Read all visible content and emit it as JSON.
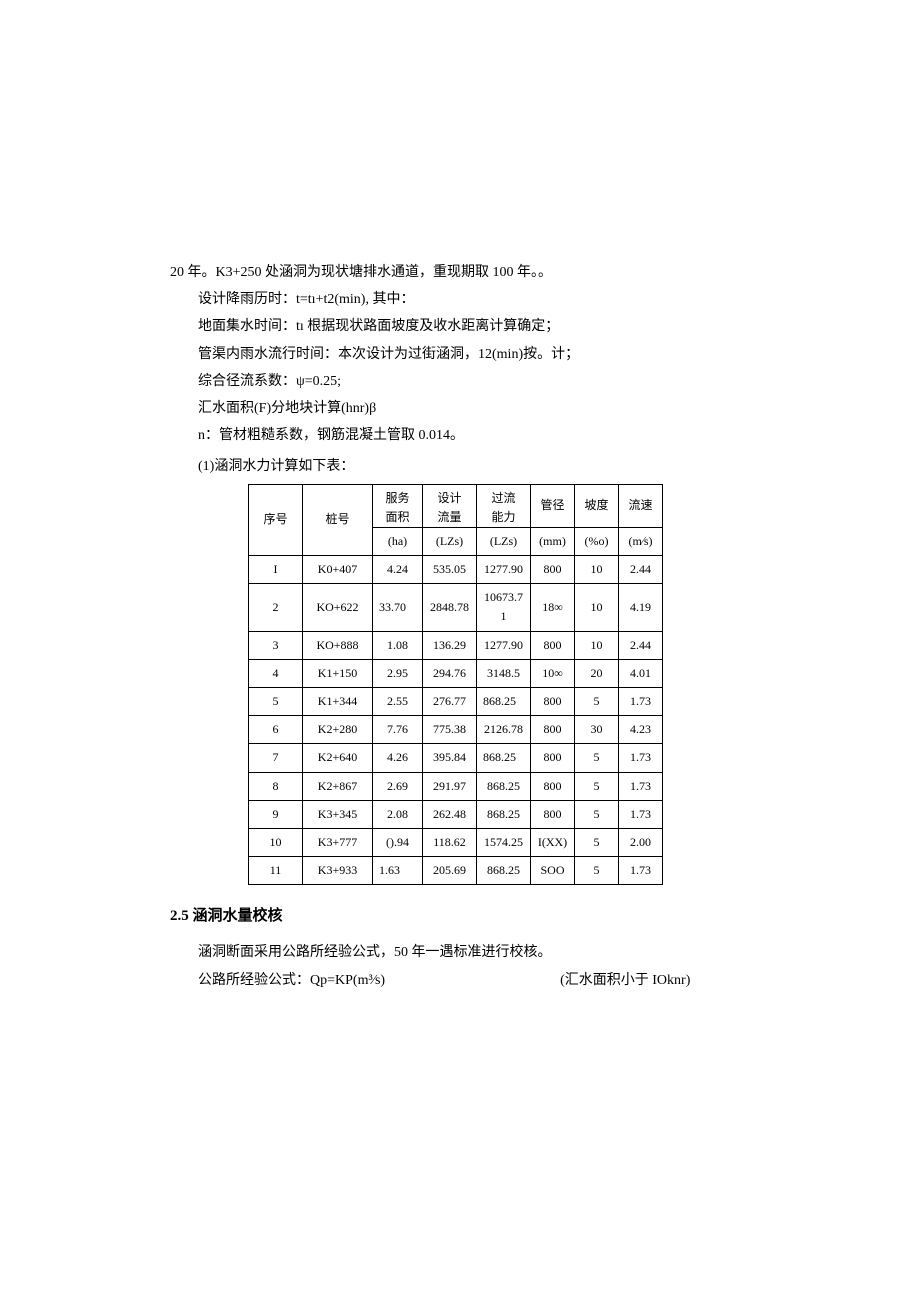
{
  "intro": {
    "line1": "20 年。K3+250 处涵洞为现状塘排水通道，重现期取 100 年。。",
    "line2": "设计降雨历时：t=tı+t2(min), 其中：",
    "line3": "地面集水时间：tı 根据现状路面坡度及收水距离计算确定；",
    "line4": "管渠内雨水流行时间：本次设计为过街涵洞，12(min)按。计；",
    "line5": "综合径流系数：ψ=0.25;",
    "line6": "汇水面积(F)分地块计算(hnr)β",
    "line7": "n：管材粗糙系数，钢筋混凝土管取 0.014。",
    "caption": "(1)涵洞水力计算如下表："
  },
  "table": {
    "head": {
      "c1": "序号",
      "c2": "桩号",
      "c3a": "服务",
      "c3b": "面积",
      "c3u": "(ha)",
      "c4a": "设计",
      "c4b": "流量",
      "c4u": "(LZs)",
      "c5a": "过流",
      "c5b": "能力",
      "c5u": "(LZs)",
      "c6a": "管径",
      "c6u": "(mm)",
      "c7a": "坡度",
      "c7u": "(%o)",
      "c8a": "流速",
      "c8u": "(m∕s)"
    },
    "rows": [
      {
        "n": "I",
        "pile": "K0+407",
        "area": "4.24",
        "design": "535.05",
        "cap": "1277.90",
        "dia": "800",
        "slope": "10",
        "vel": "2.44"
      },
      {
        "n": "2",
        "pile": "KO+622",
        "area": "33.70",
        "design": "2848.78",
        "cap": "10673.71",
        "dia": "18∞",
        "slope": "10",
        "vel": "4.19"
      },
      {
        "n": "3",
        "pile": "KO+888",
        "area": "1.08",
        "design": "136.29",
        "cap": "1277.90",
        "dia": "800",
        "slope": "10",
        "vel": "2.44"
      },
      {
        "n": "4",
        "pile": "K1+150",
        "area": "2.95",
        "design": "294.76",
        "cap": "3148.5",
        "dia": "10∞",
        "slope": "20",
        "vel": "4.01"
      },
      {
        "n": "5",
        "pile": "K1+344",
        "area": "2.55",
        "design": "276.77",
        "cap": "868.25",
        "dia": "800",
        "slope": "5",
        "vel": "1.73"
      },
      {
        "n": "6",
        "pile": "K2+280",
        "area": "7.76",
        "design": "775.38",
        "cap": "2126.78",
        "dia": "800",
        "slope": "30",
        "vel": "4.23"
      },
      {
        "n": "7",
        "pile": "K2+640",
        "area": "4.26",
        "design": "395.84",
        "cap": "868.25",
        "dia": "800",
        "slope": "5",
        "vel": "1.73"
      },
      {
        "n": "8",
        "pile": "K2+867",
        "area": "2.69",
        "design": "291.97",
        "cap": "868.25",
        "dia": "800",
        "slope": "5",
        "vel": "1.73"
      },
      {
        "n": "9",
        "pile": "K3+345",
        "area": "2.08",
        "design": "262.48",
        "cap": "868.25",
        "dia": "800",
        "slope": "5",
        "vel": "1.73"
      },
      {
        "n": "10",
        "pile": "K3+777",
        "area": "().94",
        "design": "118.62",
        "cap": "1574.25",
        "dia": "I(XX)",
        "slope": "5",
        "vel": "2.00"
      },
      {
        "n": "11",
        "pile": "K3+933",
        "area": "1.63",
        "design": "205.69",
        "cap": "868.25",
        "dia": "SOO",
        "slope": "5",
        "vel": "1.73"
      }
    ]
  },
  "section25": {
    "heading": "2.5 涵洞水量校核",
    "p1": "涵洞断面采用公路所经验公式，50 年一遇标准进行校核。",
    "p2": "公路所经验公式：Qp=KP(m³∕s)",
    "p2r": "(汇水面积小于 IOknr)"
  }
}
